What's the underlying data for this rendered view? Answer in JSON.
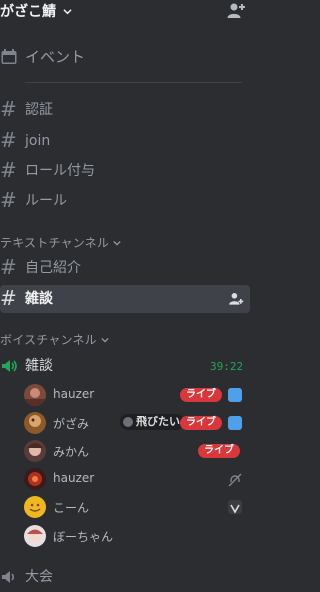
{
  "server": {
    "name": "がざこ鯖"
  },
  "channels": {
    "events_label": "イベント",
    "top": [
      {
        "name": "認証"
      },
      {
        "name": "join"
      },
      {
        "name": "ロール付与"
      },
      {
        "name": "ルール"
      }
    ],
    "text_category": "テキストチャンネル",
    "text": [
      {
        "name": "自己紹介"
      },
      {
        "name": "雑談"
      }
    ],
    "voice_category": "ボイスチャンネル",
    "voice": {
      "name": "雑談",
      "timer": "39:22",
      "users": [
        {
          "name": "hauzer",
          "live": "ライブ",
          "video": true
        },
        {
          "name": "がざみ",
          "activity": "飛びたい",
          "live": "ライブ",
          "video": true
        },
        {
          "name": "みかん",
          "live": "ライブ"
        },
        {
          "name": "hauzer",
          "deafened": true
        },
        {
          "name": "こーん",
          "status": "shield"
        },
        {
          "name": "ぼーちゃん"
        }
      ]
    },
    "bottom_voice": {
      "name": "大会"
    }
  },
  "colors": {
    "live": "#da373c",
    "timer": "#23a55a",
    "active": "#404249"
  }
}
